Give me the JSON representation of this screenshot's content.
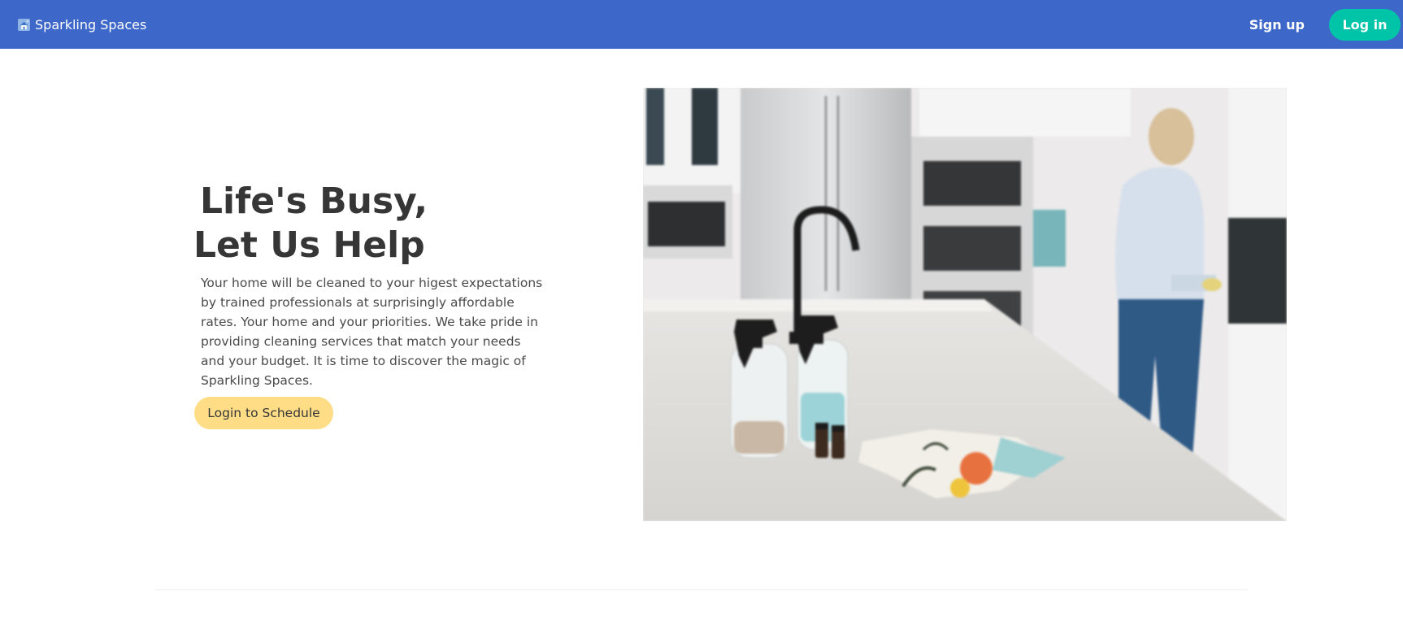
{
  "navbar": {
    "brand_name": "Sparkling Spaces",
    "brand_icon": "house-logo-icon",
    "signup_label": "Sign up",
    "login_label": "Log in",
    "background_color": "#3d67c8",
    "login_color": "#00c4a7"
  },
  "hero": {
    "title_line1": "Life's Busy,",
    "title_line2": "Let Us Help",
    "description": "Your home will be cleaned to your higest expectations by trained professionals at surprisingly affordable rates. Your home and your priorities. We take pride in providing cleaning services that match your needs and your budget. It is time to discover the magic of Sparkling Spaces.",
    "cta_label": "Login to Schedule",
    "cta_color": "#ffdd87"
  }
}
